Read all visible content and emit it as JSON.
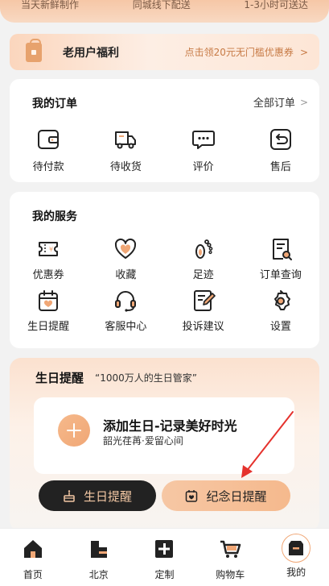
{
  "top_banner": {
    "items": [
      "当天新鲜制作",
      "同城线下配送",
      "1-3小时可送达"
    ]
  },
  "welfare": {
    "title": "老用户福利",
    "promo": "点击领20元无门槛优惠券",
    "arrow": ">"
  },
  "orders": {
    "title": "我的订单",
    "all_label": "全部订单",
    "all_chevron": ">",
    "items": [
      {
        "label": "待付款",
        "icon": "wallet-icon"
      },
      {
        "label": "待收货",
        "icon": "truck-icon"
      },
      {
        "label": "评价",
        "icon": "chat-bubble-icon"
      },
      {
        "label": "售后",
        "icon": "return-icon"
      }
    ]
  },
  "services": {
    "title": "我的服务",
    "items": [
      {
        "label": "优惠券",
        "icon": "coupon-icon"
      },
      {
        "label": "收藏",
        "icon": "heart-icon"
      },
      {
        "label": "足迹",
        "icon": "footprint-icon"
      },
      {
        "label": "订单查询",
        "icon": "order-search-icon"
      },
      {
        "label": "生日提醒",
        "icon": "calendar-icon"
      },
      {
        "label": "客服中心",
        "icon": "headset-icon"
      },
      {
        "label": "投诉建议",
        "icon": "feedback-icon"
      },
      {
        "label": "设置",
        "icon": "gear-icon"
      }
    ]
  },
  "birthday": {
    "title": "生日提醒",
    "subtitle": "“1000万人的生日管家”",
    "add_title": "添加生日-记录美好时光",
    "tagline": "韶光荏苒·爱留心间",
    "btn_birthday": "生日提醒",
    "btn_anniversary": "纪念日提醒"
  },
  "tabbar": {
    "items": [
      {
        "label": "首页",
        "icon": "home-icon"
      },
      {
        "label": "北京",
        "icon": "city-icon"
      },
      {
        "label": "定制",
        "icon": "plus-square-icon"
      },
      {
        "label": "购物车",
        "icon": "cart-icon"
      },
      {
        "label": "我的",
        "icon": "profile-box-icon",
        "active": true
      }
    ]
  },
  "colors": {
    "accent": "#f0a776",
    "annotation_arrow": "#e5322d",
    "dark": "#222222"
  }
}
